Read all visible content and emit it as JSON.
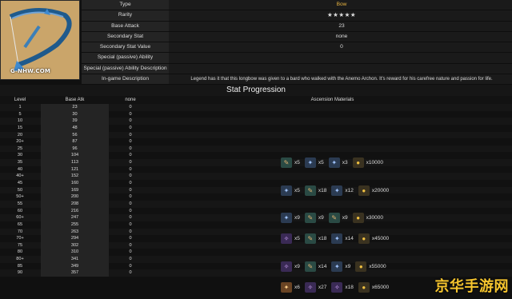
{
  "weapon": {
    "logo_text": "G-NHW.COM",
    "info": [
      {
        "key": "Type",
        "value": "Bow"
      },
      {
        "key": "Rarity",
        "value": "★★★★★"
      },
      {
        "key": "Base Attack",
        "value": "23"
      },
      {
        "key": "Secondary Stat",
        "value": "none"
      },
      {
        "key": "Secondary Stat Value",
        "value": "0"
      },
      {
        "key": "Special (passive) Ability",
        "value": ""
      },
      {
        "key": "Special (passive) Ability Description",
        "value": ""
      },
      {
        "key": "In-game Description",
        "value": "Legend has it that this longbow was given to a bard who walked with the Anemo Archon. It's reward for his carefree nature and passion for life."
      }
    ]
  },
  "stat_progression": {
    "title": "Stat Progression",
    "headers": {
      "level": "Level",
      "base_atk": "Base Atk",
      "secondary": "none",
      "materials": "Ascension Materials"
    },
    "rows": [
      {
        "level": "1",
        "atk": "23",
        "sec": "0"
      },
      {
        "level": "5",
        "atk": "30",
        "sec": "0"
      },
      {
        "level": "10",
        "atk": "39",
        "sec": "0"
      },
      {
        "level": "15",
        "atk": "48",
        "sec": "0"
      },
      {
        "level": "20",
        "atk": "56",
        "sec": "0"
      },
      {
        "level": "20+",
        "atk": "87",
        "sec": "0"
      },
      {
        "level": "25",
        "atk": "96",
        "sec": "0"
      },
      {
        "level": "30",
        "atk": "104",
        "sec": "0"
      },
      {
        "level": "35",
        "atk": "113",
        "sec": "0"
      },
      {
        "level": "40",
        "atk": "121",
        "sec": "0"
      },
      {
        "level": "40+",
        "atk": "152",
        "sec": "0"
      },
      {
        "level": "45",
        "atk": "160",
        "sec": "0"
      },
      {
        "level": "50",
        "atk": "169",
        "sec": "0"
      },
      {
        "level": "50+",
        "atk": "200",
        "sec": "0"
      },
      {
        "level": "55",
        "atk": "208",
        "sec": "0"
      },
      {
        "level": "60",
        "atk": "216",
        "sec": "0"
      },
      {
        "level": "60+",
        "atk": "247",
        "sec": "0"
      },
      {
        "level": "65",
        "atk": "255",
        "sec": "0"
      },
      {
        "level": "70",
        "atk": "263",
        "sec": "0"
      },
      {
        "level": "70+",
        "atk": "294",
        "sec": "0"
      },
      {
        "level": "75",
        "atk": "302",
        "sec": "0"
      },
      {
        "level": "80",
        "atk": "310",
        "sec": "0"
      },
      {
        "level": "80+",
        "atk": "341",
        "sec": "0"
      },
      {
        "level": "85",
        "atk": "349",
        "sec": "0"
      },
      {
        "level": "90",
        "atk": "357",
        "sec": "0"
      }
    ],
    "ascensions": [
      {
        "row": 8,
        "items": [
          {
            "icon": "teal",
            "qty": "x5"
          },
          {
            "icon": "blue",
            "qty": "x5"
          },
          {
            "icon": "blue",
            "qty": "x3"
          },
          {
            "icon": "mora",
            "qty": "x10000"
          }
        ]
      },
      {
        "row": 12,
        "items": [
          {
            "icon": "blue",
            "qty": "x5"
          },
          {
            "icon": "teal",
            "qty": "x18"
          },
          {
            "icon": "blue",
            "qty": "x12"
          },
          {
            "icon": "mora",
            "qty": "x20000"
          }
        ]
      },
      {
        "row": 16,
        "items": [
          {
            "icon": "blue",
            "qty": "x9"
          },
          {
            "icon": "teal",
            "qty": "x9"
          },
          {
            "icon": "teal",
            "qty": "x9"
          },
          {
            "icon": "mora",
            "qty": "x30000"
          }
        ]
      },
      {
        "row": 19,
        "items": [
          {
            "icon": "purple",
            "qty": "x5"
          },
          {
            "icon": "teal",
            "qty": "x18"
          },
          {
            "icon": "blue",
            "qty": "x14"
          },
          {
            "icon": "mora",
            "qty": "x45000"
          }
        ]
      },
      {
        "row": 23,
        "items": [
          {
            "icon": "purple",
            "qty": "x9"
          },
          {
            "icon": "teal",
            "qty": "x14"
          },
          {
            "icon": "blue",
            "qty": "x9"
          },
          {
            "icon": "mora",
            "qty": "x55000"
          }
        ]
      },
      {
        "row": 26,
        "items": [
          {
            "icon": "orange",
            "qty": "x6"
          },
          {
            "icon": "purple",
            "qty": "x27"
          },
          {
            "icon": "purple",
            "qty": "x18"
          },
          {
            "icon": "mora",
            "qty": "x65000"
          }
        ]
      }
    ]
  },
  "watermark": "京华手游网"
}
